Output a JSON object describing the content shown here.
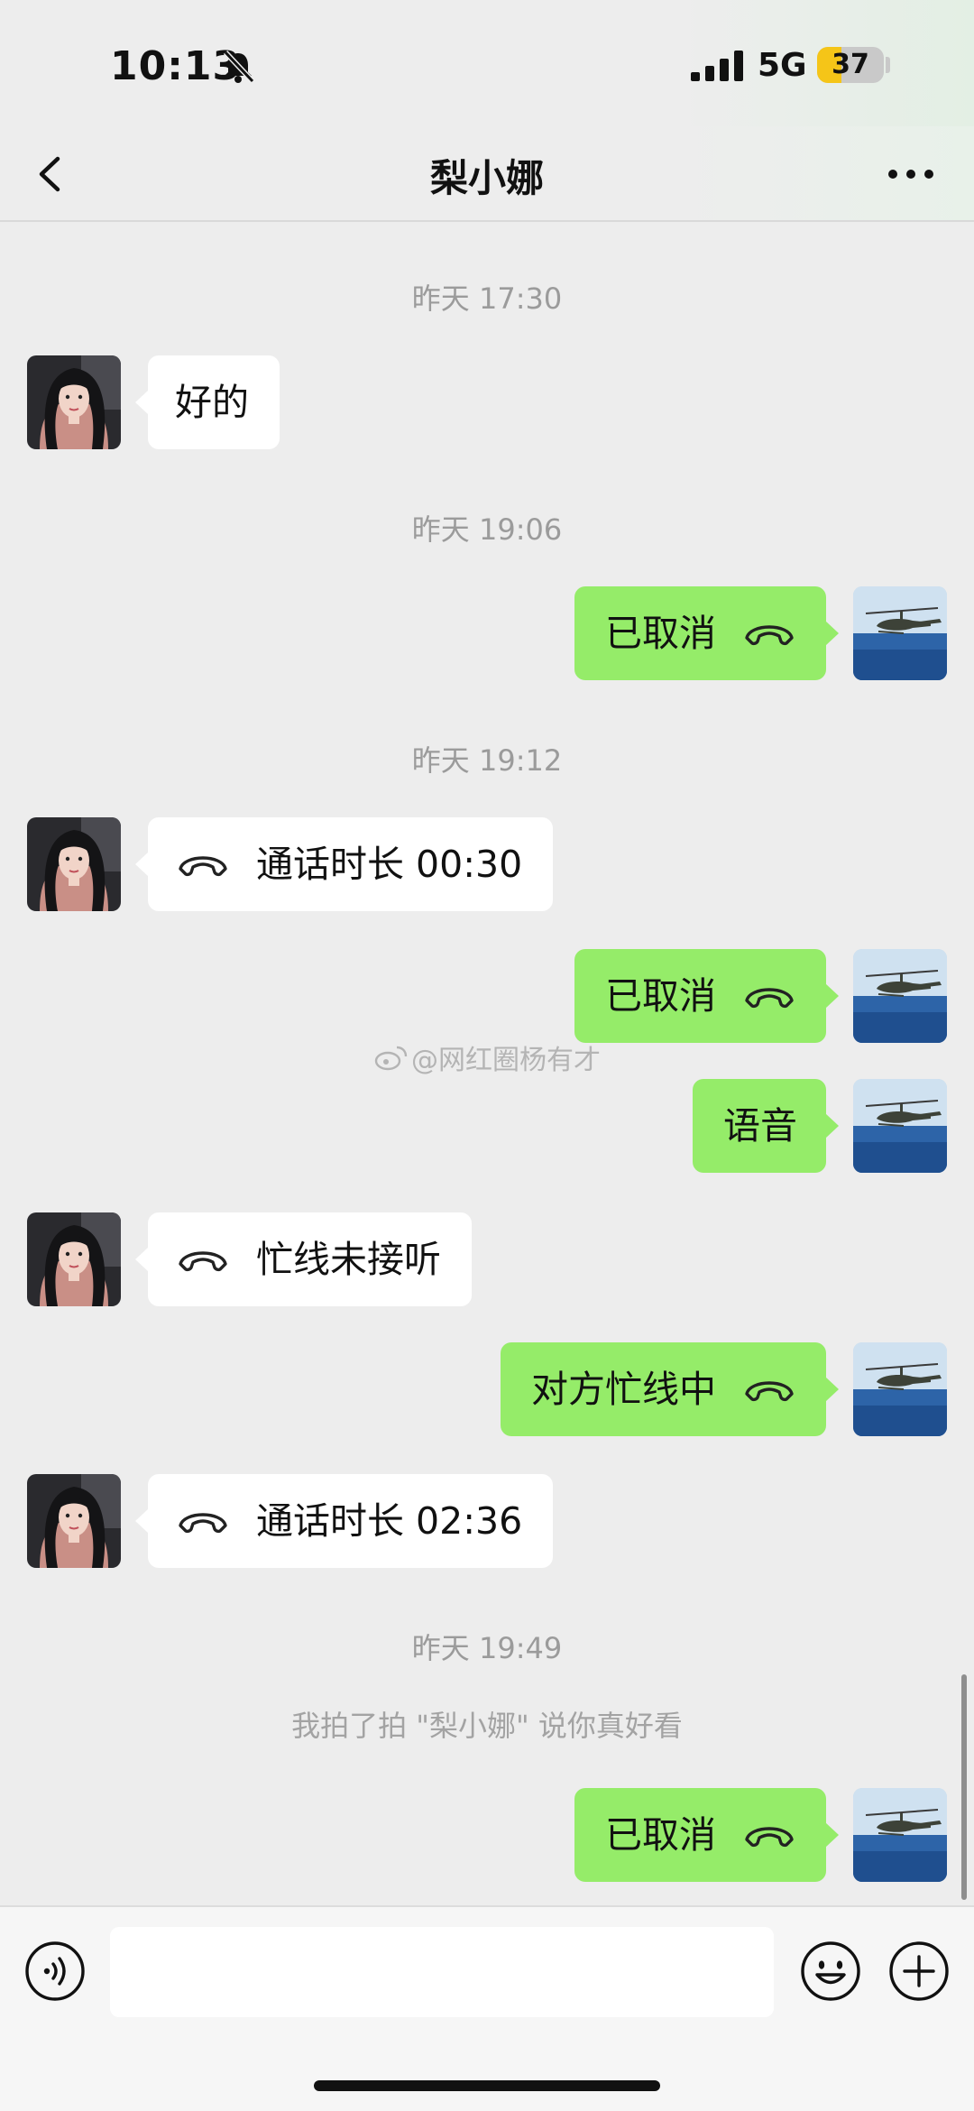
{
  "status_bar": {
    "time": "10:13",
    "network": "5G",
    "battery": "37",
    "battery_level": 0.37
  },
  "header": {
    "title": "梨小娜"
  },
  "messages": [
    {
      "kind": "time",
      "text": "昨天 17:30"
    },
    {
      "kind": "in",
      "text": "好的",
      "call": false
    },
    {
      "kind": "time",
      "text": "昨天 19:06"
    },
    {
      "kind": "out",
      "text": "已取消",
      "call": true
    },
    {
      "kind": "time",
      "text": "昨天 19:12"
    },
    {
      "kind": "in",
      "text": "通话时长 00:30",
      "call": true
    },
    {
      "kind": "out",
      "text": "已取消",
      "call": true
    },
    {
      "kind": "out",
      "text": "语音",
      "call": false
    },
    {
      "kind": "in",
      "text": "忙线未接听",
      "call": true
    },
    {
      "kind": "out",
      "text": "对方忙线中",
      "call": true
    },
    {
      "kind": "in",
      "text": "通话时长 02:36",
      "call": true
    },
    {
      "kind": "time",
      "text": "昨天 19:49"
    },
    {
      "kind": "system",
      "text": "我拍了拍 \"梨小娜\" 说你真好看"
    },
    {
      "kind": "out",
      "text": "已取消",
      "call": true
    }
  ],
  "watermark": "@网红圈杨有才",
  "input": {
    "value": "",
    "placeholder": ""
  },
  "colors": {
    "chat_background": "#ededed",
    "outgoing_bubble": "#95ec69",
    "incoming_bubble": "#ffffff",
    "timestamp_text": "#9b9b9b",
    "battery_accent": "#f5c518"
  },
  "icons": {
    "back": "chevron-left-icon",
    "more": "more-dots-icon",
    "call": "phone-handset-icon",
    "voice": "voice-mode-icon",
    "emoji": "emoji-icon",
    "plus": "plus-circle-icon",
    "bell_off": "bell-off-icon",
    "signal": "signal-icon"
  }
}
